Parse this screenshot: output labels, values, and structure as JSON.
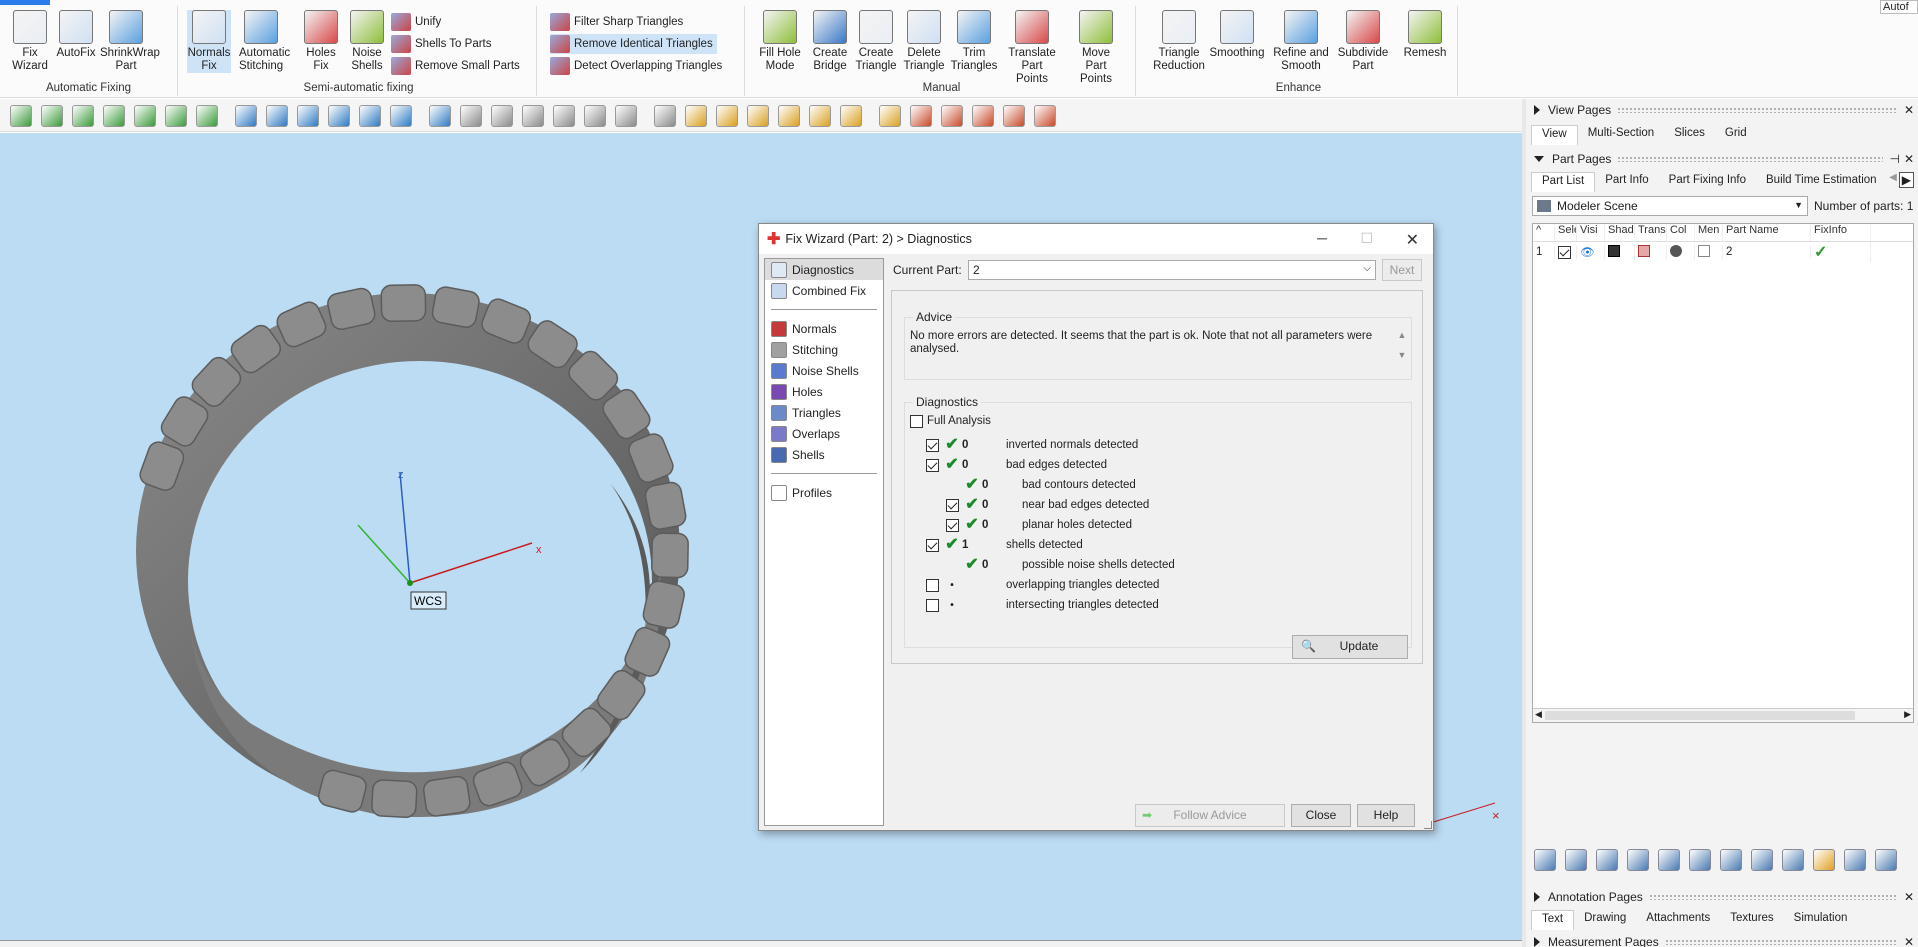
{
  "ribbon": {
    "auto_tab": "Autof",
    "groups": {
      "automatic": {
        "label": "Automatic Fixing",
        "buttons": [
          {
            "label": "Fix\nWizard"
          },
          {
            "label": "AutoFix"
          },
          {
            "label": "ShrinkWrap\nPart"
          }
        ]
      },
      "semiauto": {
        "label": "Semi-automatic fixing",
        "buttons": [
          {
            "label": "Normals\nFix"
          },
          {
            "label": "Automatic\nStitching"
          },
          {
            "label": "Holes\nFix"
          },
          {
            "label": "Noise\nShells"
          }
        ],
        "small": [
          "Unify",
          "Shells To Parts",
          "Remove Small Parts"
        ]
      },
      "triangles": {
        "small": [
          "Filter Sharp Triangles",
          "Remove Identical Triangles",
          "Detect Overlapping Triangles"
        ]
      },
      "manual": {
        "label": "Manual",
        "buttons": [
          {
            "label": "Fill Hole\nMode"
          },
          {
            "label": "Create\nBridge"
          },
          {
            "label": "Create\nTriangle"
          },
          {
            "label": "Delete\nTriangle"
          },
          {
            "label": "Trim\nTriangles"
          },
          {
            "label": "Translate\nPart Points"
          },
          {
            "label": "Move Part\nPoints"
          }
        ]
      },
      "enhance": {
        "label": "Enhance",
        "buttons": [
          {
            "label": "Triangle\nReduction"
          },
          {
            "label": "Smoothing"
          },
          {
            "label": "Refine and\nSmooth"
          },
          {
            "label": "Subdivide\nPart"
          },
          {
            "label": "Remesh"
          }
        ]
      }
    }
  },
  "viewport": {
    "wcs_label": "WCS",
    "axis_x": "x",
    "axis_z": "z"
  },
  "dialog": {
    "title": "Fix Wizard (Part: 2) > Diagnostics",
    "nav": [
      "Diagnostics",
      "Combined Fix",
      "Normals",
      "Stitching",
      "Noise Shells",
      "Holes",
      "Triangles",
      "Overlaps",
      "Shells",
      "Profiles"
    ],
    "current_part_label": "Current Part:",
    "current_part_value": "2",
    "next_label": "Next",
    "advice_title": "Advice",
    "advice_text": "No more errors are detected. It seems that the part is ok. Note that not all parameters were analysed.",
    "diagnostics_title": "Diagnostics",
    "full_analysis_label": "Full Analysis",
    "rows": [
      {
        "checkbox": true,
        "checked": true,
        "status": "tick",
        "count": "0",
        "text": "inverted normals detected",
        "indent": 0
      },
      {
        "checkbox": true,
        "checked": true,
        "status": "tick",
        "count": "0",
        "text": "bad edges detected",
        "indent": 0
      },
      {
        "checkbox": false,
        "checked": false,
        "status": "tick",
        "count": "0",
        "text": "bad contours detected",
        "indent": 1
      },
      {
        "checkbox": true,
        "checked": true,
        "status": "tick",
        "count": "0",
        "text": "near bad edges detected",
        "indent": 1
      },
      {
        "checkbox": true,
        "checked": true,
        "status": "tick",
        "count": "0",
        "text": "planar holes detected",
        "indent": 1
      },
      {
        "checkbox": true,
        "checked": true,
        "status": "tick",
        "count": "1",
        "text": "shells detected",
        "indent": 0
      },
      {
        "checkbox": false,
        "checked": false,
        "status": "tick",
        "count": "0",
        "text": "possible noise shells detected",
        "indent": 1
      },
      {
        "checkbox": true,
        "checked": false,
        "status": "dot",
        "count": "",
        "text": "overlapping triangles detected",
        "indent": 0
      },
      {
        "checkbox": true,
        "checked": false,
        "status": "dot",
        "count": "",
        "text": "intersecting triangles detected",
        "indent": 0
      }
    ],
    "update_label": "Update",
    "follow_advice_label": "Follow Advice",
    "close_label": "Close",
    "help_label": "Help"
  },
  "right_panel": {
    "view_pages": {
      "title": "View Pages",
      "tabs": [
        "View",
        "Multi-Section",
        "Slices",
        "Grid"
      ]
    },
    "part_pages": {
      "title": "Part Pages",
      "tabs": [
        "Part List",
        "Part Info",
        "Part Fixing Info",
        "Build Time Estimation"
      ],
      "scene_select": "Modeler Scene",
      "num_parts_label": "Number of parts:",
      "num_parts": "1",
      "columns": [
        "^",
        "Sele",
        "Visi",
        "Shad",
        "Trans",
        "Col",
        "Men",
        "Part Name",
        "FixInfo"
      ],
      "rows": [
        {
          "index": "1",
          "name": "2"
        }
      ]
    },
    "annotation_pages": {
      "title": "Annotation Pages",
      "tabs": [
        "Text",
        "Drawing",
        "Attachments",
        "Textures",
        "Simulation"
      ]
    },
    "measurement_pages": {
      "title": "Measurement Pages"
    }
  }
}
